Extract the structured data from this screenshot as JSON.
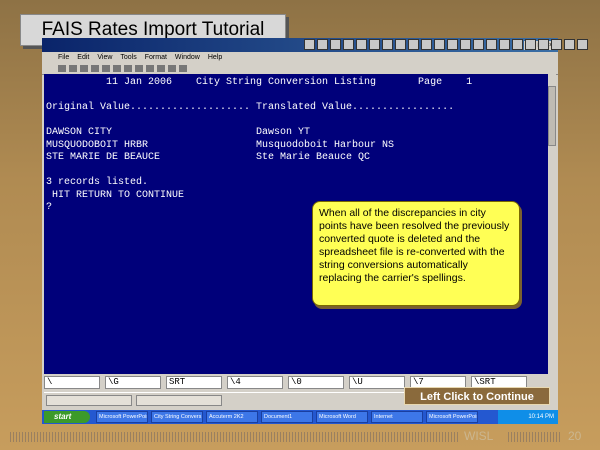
{
  "slide": {
    "title": "FAIS Rates Import Tutorial",
    "continue_label": "Left Click to Continue",
    "footer_brand": "WISL",
    "page_number": "20"
  },
  "app": {
    "window_buttons": [
      "_",
      "□",
      "×"
    ],
    "menu": [
      "File",
      "Edit",
      "View",
      "Tools",
      "Format",
      "Window",
      "Help"
    ]
  },
  "terminal": {
    "header": "          11 Jan 2006    City String Conversion Listing       Page    1",
    "column_header": "Original Value.................... Translated Value.................",
    "rows": [
      {
        "original": "DAWSON CITY",
        "translated": "Dawson YT"
      },
      {
        "original": "MUSQUODOBOIT HRBR",
        "translated": "Musquodoboit Harbour NS"
      },
      {
        "original": "STE MARIE DE BEAUCE",
        "translated": "Ste Marie Beauce QC"
      }
    ],
    "records_line": "3 records listed.",
    "prompt_line": " HIT RETURN TO CONTINUE",
    "cursor_line": "?"
  },
  "function_keys": [
    "\\",
    "\\G",
    "SRT",
    "\\4",
    "\\0",
    "\\U",
    "\\7",
    "\\SRT"
  ],
  "callout": "When all of the discrepancies in city points have been resolved the previously converted quote is deleted and the spreadsheet file is re-converted with the string conversions automatically replacing the carrier's spellings.",
  "taskbar": {
    "start": "start",
    "tasks": [
      "Microsoft PowerPoint",
      "City String Convers",
      "Accuterm 2K2",
      "Document1",
      "Microsoft Word",
      "Internet",
      "Microsoft PowerPoint"
    ],
    "clock": "10:14 PM"
  }
}
